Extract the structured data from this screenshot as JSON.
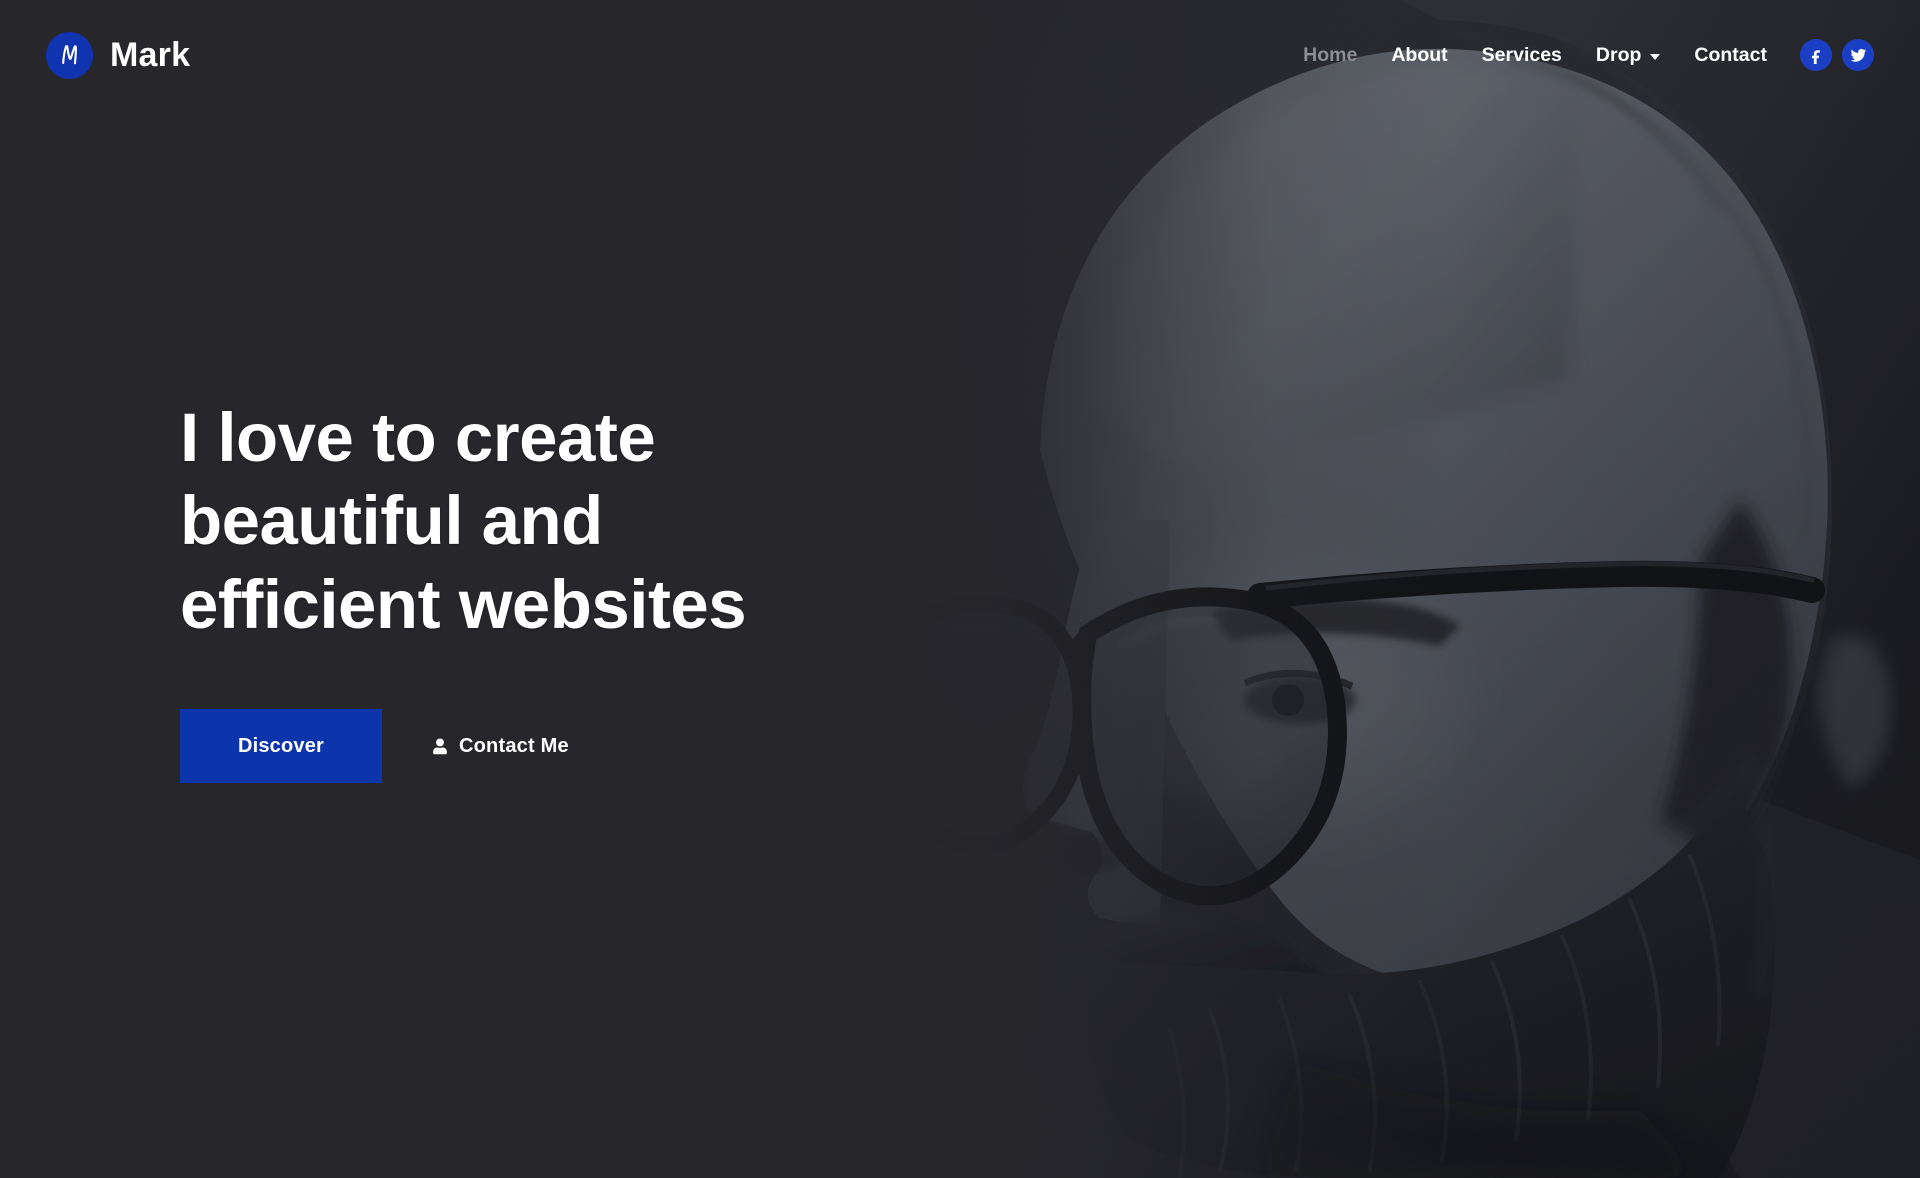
{
  "brand": {
    "logo_icon": "m-monogram-icon",
    "name": "Mark",
    "logo_color": "#1033b0"
  },
  "nav": {
    "items": [
      {
        "label": "Home",
        "state": "muted",
        "has_dropdown": false
      },
      {
        "label": "About",
        "state": "active",
        "has_dropdown": false
      },
      {
        "label": "Services",
        "state": "active",
        "has_dropdown": false
      },
      {
        "label": "Drop",
        "state": "active",
        "has_dropdown": true
      },
      {
        "label": "Contact",
        "state": "active",
        "has_dropdown": false
      }
    ],
    "socials": [
      {
        "name": "facebook-icon",
        "color": "#1a3fc4"
      },
      {
        "name": "twitter-icon",
        "color": "#1a3fc4"
      }
    ]
  },
  "hero": {
    "title": "I love to create beautiful and efficient websites",
    "title_line_1": "I love to create",
    "title_line_2": "beautiful and",
    "title_line_3": "efficient websites",
    "primary_button": {
      "label": "Discover",
      "background": "#0d35ab",
      "text_color": "#ffffff"
    },
    "secondary_button": {
      "label": "Contact Me",
      "icon": "user-icon",
      "text_color": "#ffffff"
    },
    "background_color": "#26262b",
    "photo_alt": "Portrait of a bearded man wearing round glasses in profile"
  }
}
